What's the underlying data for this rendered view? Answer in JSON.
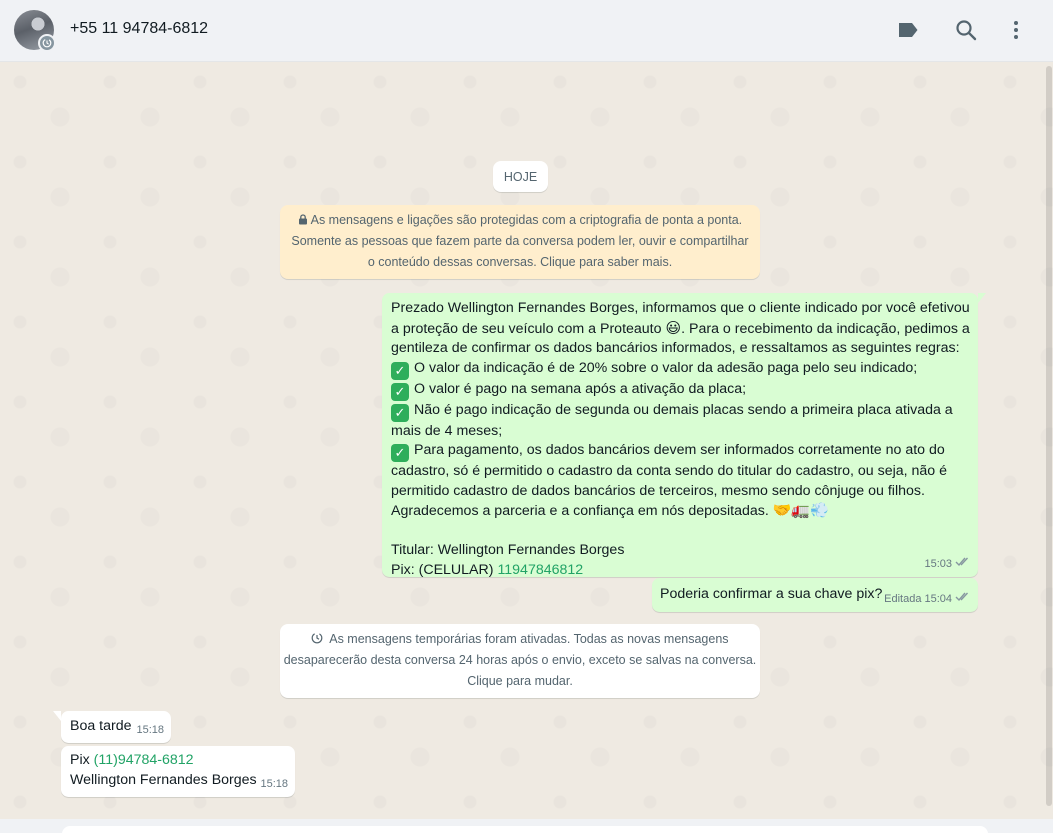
{
  "header": {
    "contact_name": "+55 11 94784-6812",
    "icons": [
      "label-icon",
      "search-icon",
      "menu-icon"
    ]
  },
  "chat": {
    "date_chip": "HOJE",
    "encryption_notice": [
      "As mensagens e ligações são protegidas com a criptografia de ponta a ponta.",
      "Somente as pessoas que fazem parte da conversa podem ler, ouvir e compartilhar",
      "o conteúdo dessas conversas. Clique para saber mais."
    ],
    "main_message": {
      "lines": [
        "Prezado Wellington Fernandes Borges, informamos que o cliente indicado por você efetivou",
        "a proteção de seu veículo com a Proteauto",
        ". Para o recebimento da indicação, pedimos a",
        "gentileza de confirmar os dados bancários informados, e  ressaltamos as seguintes regras:",
        "O valor da indicação é de 20% sobre o valor da adesão paga pelo seu indicado;",
        "O valor é pago na semana após a ativação da placa;",
        "Não é pago indicação de segunda ou demais placas sendo a primeira placa ativada a",
        "mais de 4 meses;",
        "Para pagamento, os dados bancários devem ser informados corretamente no ato do",
        "cadastro, só é permitido o cadastro da conta sendo do titular do cadastro, ou seja, não é",
        "permitido cadastro de dados bancários de terceiros, mesmo sendo cônjuge ou filhos.",
        "Agradecemos a parceria e a confiança em nós depositadas.",
        "Titular: Wellington Fernandes Borges",
        "Pix: (CELULAR) ",
        "11947846812"
      ],
      "emoji_smile": "😃",
      "emoji_trail": "🤝🚛💨",
      "time": "15:03"
    },
    "confirm_message": {
      "text": "Poderia confirmar a sua chave pix?",
      "edited": "Editada",
      "time": "15:04"
    },
    "temporary_notice": [
      "As mensagens temporárias foram ativadas. Todas as novas mensagens",
      "desaparecerão desta conversa 24 horas após o envio, exceto se salvas na conversa.",
      "Clique para mudar."
    ],
    "incoming_1": {
      "text": "Boa tarde",
      "time": "15:18"
    },
    "incoming_2": {
      "prefix": "Pix ",
      "phone": "(11)94784-6812",
      "name": "Wellington Fernandes Borges",
      "time": "15:18"
    }
  },
  "colors": {
    "outgoing_bubble": "#d9fdd3",
    "incoming_bubble": "#ffffff",
    "chat_bg": "#efeae2",
    "header_bg": "#f0f2f5",
    "notice_yellow": "#ffeecd",
    "link_green": "#21a366"
  }
}
